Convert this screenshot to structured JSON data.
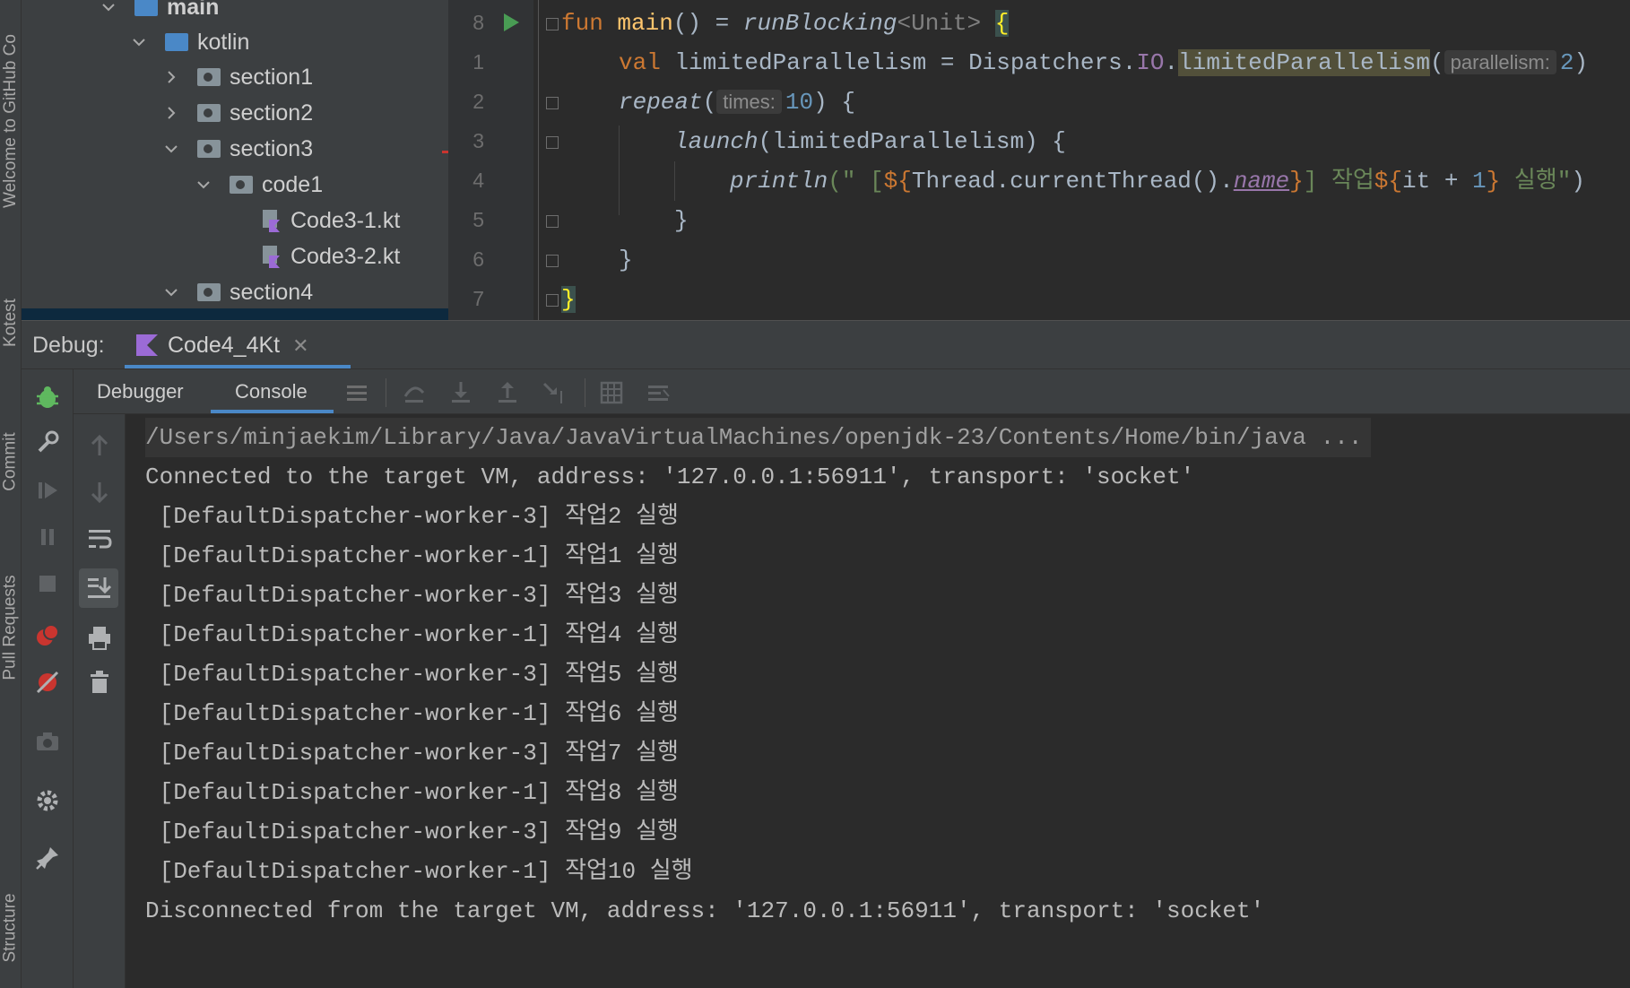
{
  "left_strip": {
    "tabs": [
      "Welcome to GitHub Co",
      "Kotest",
      "Commit",
      "Pull Requests",
      "Structure"
    ]
  },
  "project_tree": {
    "items": [
      {
        "label": "main",
        "type": "folder-blue",
        "expanded": true
      },
      {
        "label": "kotlin",
        "type": "folder-blue",
        "expanded": true
      },
      {
        "label": "section1",
        "type": "package",
        "expanded": false
      },
      {
        "label": "section2",
        "type": "package",
        "expanded": false
      },
      {
        "label": "section3",
        "type": "package",
        "expanded": true
      },
      {
        "label": "code1",
        "type": "package",
        "expanded": true
      },
      {
        "label": "Code3-1.kt",
        "type": "kotlin-file"
      },
      {
        "label": "Code3-2.kt",
        "type": "kotlin-file"
      },
      {
        "label": "section4",
        "type": "package",
        "expanded": true
      }
    ]
  },
  "editor": {
    "line_numbers": [
      "8",
      "1",
      "2",
      "3",
      "4",
      "5",
      "6",
      "7"
    ],
    "tokens": {
      "fun": "fun",
      "main": "main",
      "eq_paren": "() = ",
      "runBlocking": "runBlocking",
      "unit_generic": "<Unit>",
      "open_brace": "{",
      "val": "val",
      "lp_decl": " limitedParallelism = Dispatchers.",
      "io": "IO",
      "dot": ".",
      "lp_call": "limitedParallelism",
      "open_paren": "(",
      "hint_parallelism": "parallelism:",
      "two": "2",
      "close_paren": ")",
      "repeat": "repeat",
      "hint_times": "times:",
      "ten": "10",
      "repeat_end": ") {",
      "launch": "launch",
      "launch_args": "(limitedParallelism) {",
      "println": "println",
      "str_open": "(\" [",
      "tmpl_open": "${",
      "thread_call": "Thread.currentThread().",
      "name": "name",
      "tmpl_close": "}",
      "str_mid": "] 작업",
      "it": "it",
      "plus": " + ",
      "one": "1",
      "str_end": " 실행\"",
      "println_close": ")",
      "inner_close": "}",
      "outer_close": "}",
      "final_close": "}"
    }
  },
  "debug": {
    "label": "Debug:",
    "run_tab": "Code4_4Kt",
    "tabs": {
      "debugger": "Debugger",
      "console": "Console"
    }
  },
  "console": {
    "lines": [
      "/Users/minjaekim/Library/Java/JavaVirtualMachines/openjdk-23/Contents/Home/bin/java ...",
      "Connected to the target VM, address: '127.0.0.1:56911', transport: 'socket'",
      " [DefaultDispatcher-worker-3] 작업2 실행",
      " [DefaultDispatcher-worker-1] 작업1 실행",
      " [DefaultDispatcher-worker-3] 작업3 실행",
      " [DefaultDispatcher-worker-1] 작업4 실행",
      " [DefaultDispatcher-worker-3] 작업5 실행",
      " [DefaultDispatcher-worker-1] 작업6 실행",
      " [DefaultDispatcher-worker-3] 작업7 실행",
      " [DefaultDispatcher-worker-1] 작업8 실행",
      " [DefaultDispatcher-worker-3] 작업9 실행",
      " [DefaultDispatcher-worker-1] 작업10 실행",
      "Disconnected from the target VM, address: '127.0.0.1:56911', transport: 'socket'"
    ]
  },
  "colors": {
    "accent": "#4a88c7",
    "background": "#2b2b2b",
    "panel": "#3c3f41",
    "run_green": "#499c54",
    "debug_green": "#5fb85f",
    "breakpoint_red": "#c9352f"
  }
}
